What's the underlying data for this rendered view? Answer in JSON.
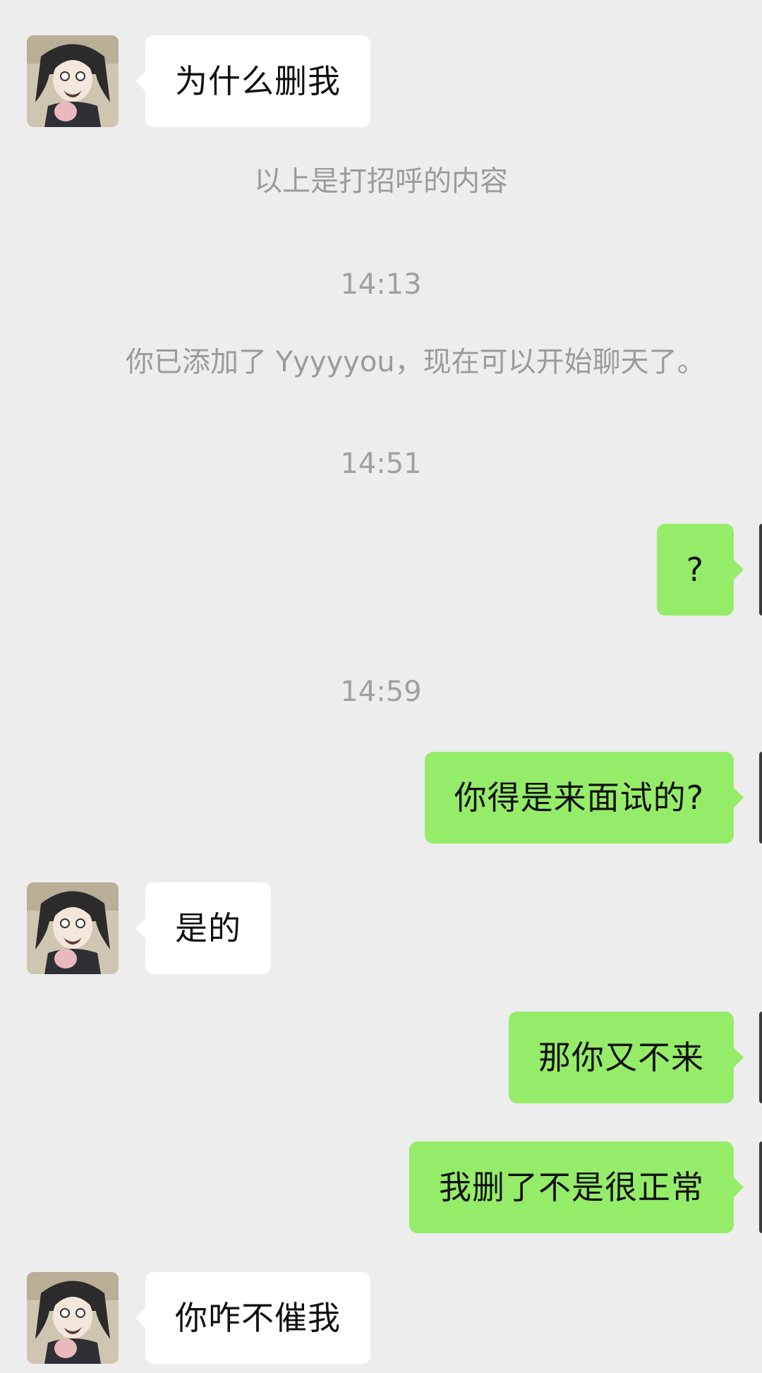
{
  "messages": [
    {
      "kind": "in",
      "text": "为什么删我"
    },
    {
      "kind": "system",
      "text": "以上是打招呼的内容"
    },
    {
      "kind": "time",
      "text": "14:13"
    },
    {
      "kind": "notice",
      "text": "你已添加了 Yyyyyou，现在可以开始聊天了。"
    },
    {
      "kind": "time",
      "text": "14:51"
    },
    {
      "kind": "out",
      "text": "?"
    },
    {
      "kind": "time",
      "text": "14:59"
    },
    {
      "kind": "out",
      "text": "你得是来面试的?"
    },
    {
      "kind": "in",
      "text": "是的"
    },
    {
      "kind": "out",
      "text": "那你又不来"
    },
    {
      "kind": "out",
      "text": "我删了不是很正常"
    },
    {
      "kind": "in",
      "text": "你咋不催我"
    }
  ],
  "colors": {
    "background": "#ededed",
    "incoming_bubble": "#ffffff",
    "outgoing_bubble": "#95ec69",
    "system_text": "#9b9b9b"
  },
  "icons": {
    "contact_avatar": "anime-character-avatar",
    "self_avatar": "self-avatar-edge"
  }
}
